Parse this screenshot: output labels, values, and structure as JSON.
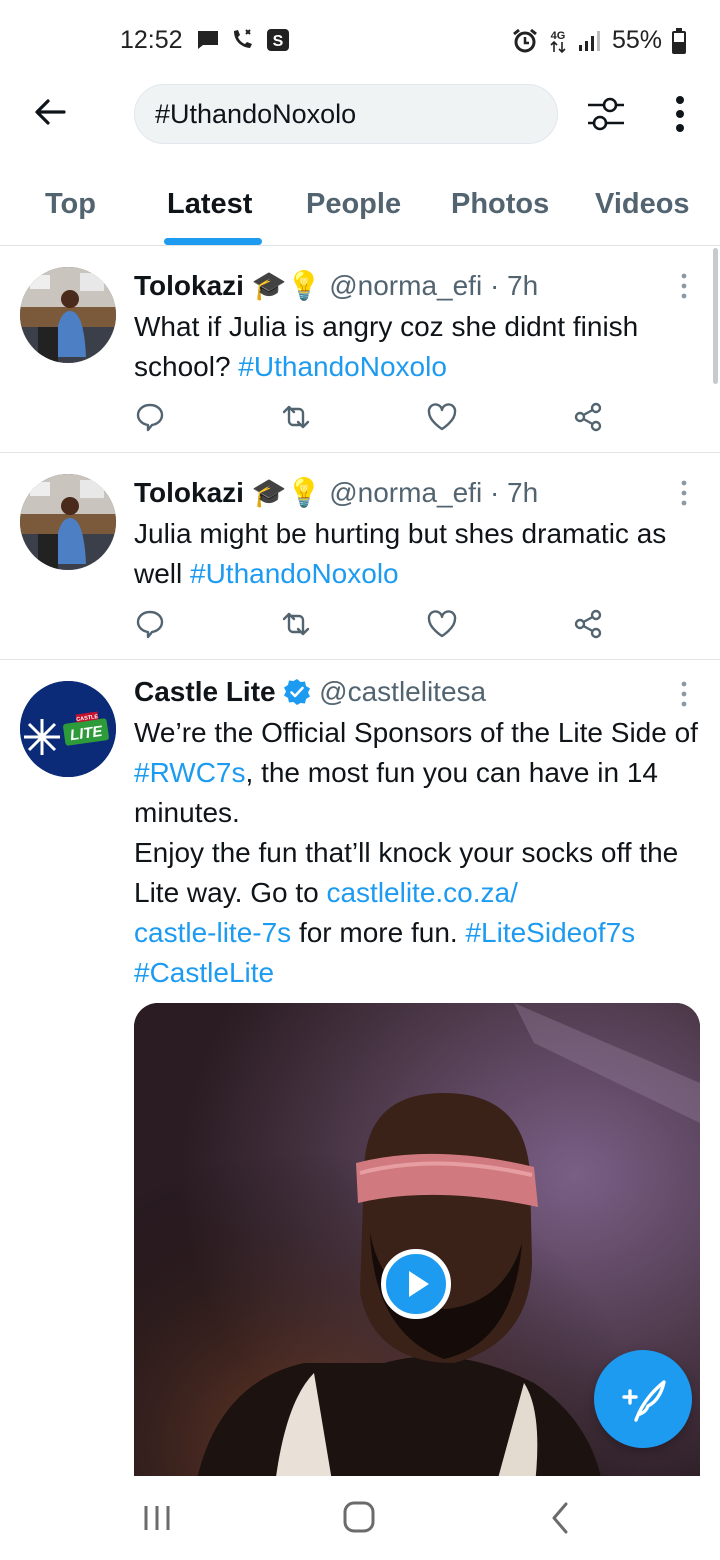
{
  "status_bar": {
    "time": "12:52",
    "battery": "55%",
    "network": "4G",
    "left_icons": [
      "message-icon",
      "wifi-call-icon",
      "s-app-icon"
    ],
    "right_icons": [
      "alarm-icon",
      "network-4g-icon",
      "signal-icon",
      "battery-icon"
    ]
  },
  "header": {
    "search_query": "#UthandoNoxolo",
    "icons": [
      "back-arrow-icon",
      "filter-sliders-icon",
      "more-vertical-icon"
    ]
  },
  "tabs": {
    "items": [
      "Top",
      "Latest",
      "People",
      "Photos",
      "Videos"
    ],
    "active": "Latest"
  },
  "tweets": [
    {
      "name": "Tolokazi",
      "name_emojis": "🎓💡",
      "handle": "@norma_efi",
      "time": "· 7h",
      "text": "What if Julia is angry coz she didnt finish school? ",
      "hashtag": "#UthandoNoxolo"
    },
    {
      "name": "Tolokazi",
      "name_emojis": "🎓💡",
      "handle": "@norma_efi",
      "time": "· 7h",
      "text": "Julia might be hurting but shes dramatic as well  ",
      "hashtag": "#UthandoNoxolo"
    },
    {
      "name": "Castle Lite",
      "handle": "@castlelitesa",
      "verified": true,
      "text_part1": "We’re the Official Sponsors of the Lite Side of ",
      "hashtag1": "#RWC7s",
      "text_part2": ", the most fun you can have in 14 minutes.",
      "text_part3": "Enjoy the fun that’ll knock your socks off the Lite way. Go to ",
      "link": "castlelite.co.za/\ncastle-lite-7s",
      "text_part4": " for more fun. ",
      "hashtag2": "#LiteSideof7s",
      "hashtag3": "#CastleLite",
      "avatar_badge": "CASTLE",
      "avatar_word": "LITE"
    }
  ],
  "action_icons": [
    "reply-icon",
    "retweet-icon",
    "like-icon",
    "share-icon"
  ],
  "colors": {
    "accent": "#1d9bf0",
    "text": "#0f1419",
    "secondary": "#536471",
    "castle_blue": "#0b2a78",
    "castle_green": "#2e9b3a"
  }
}
